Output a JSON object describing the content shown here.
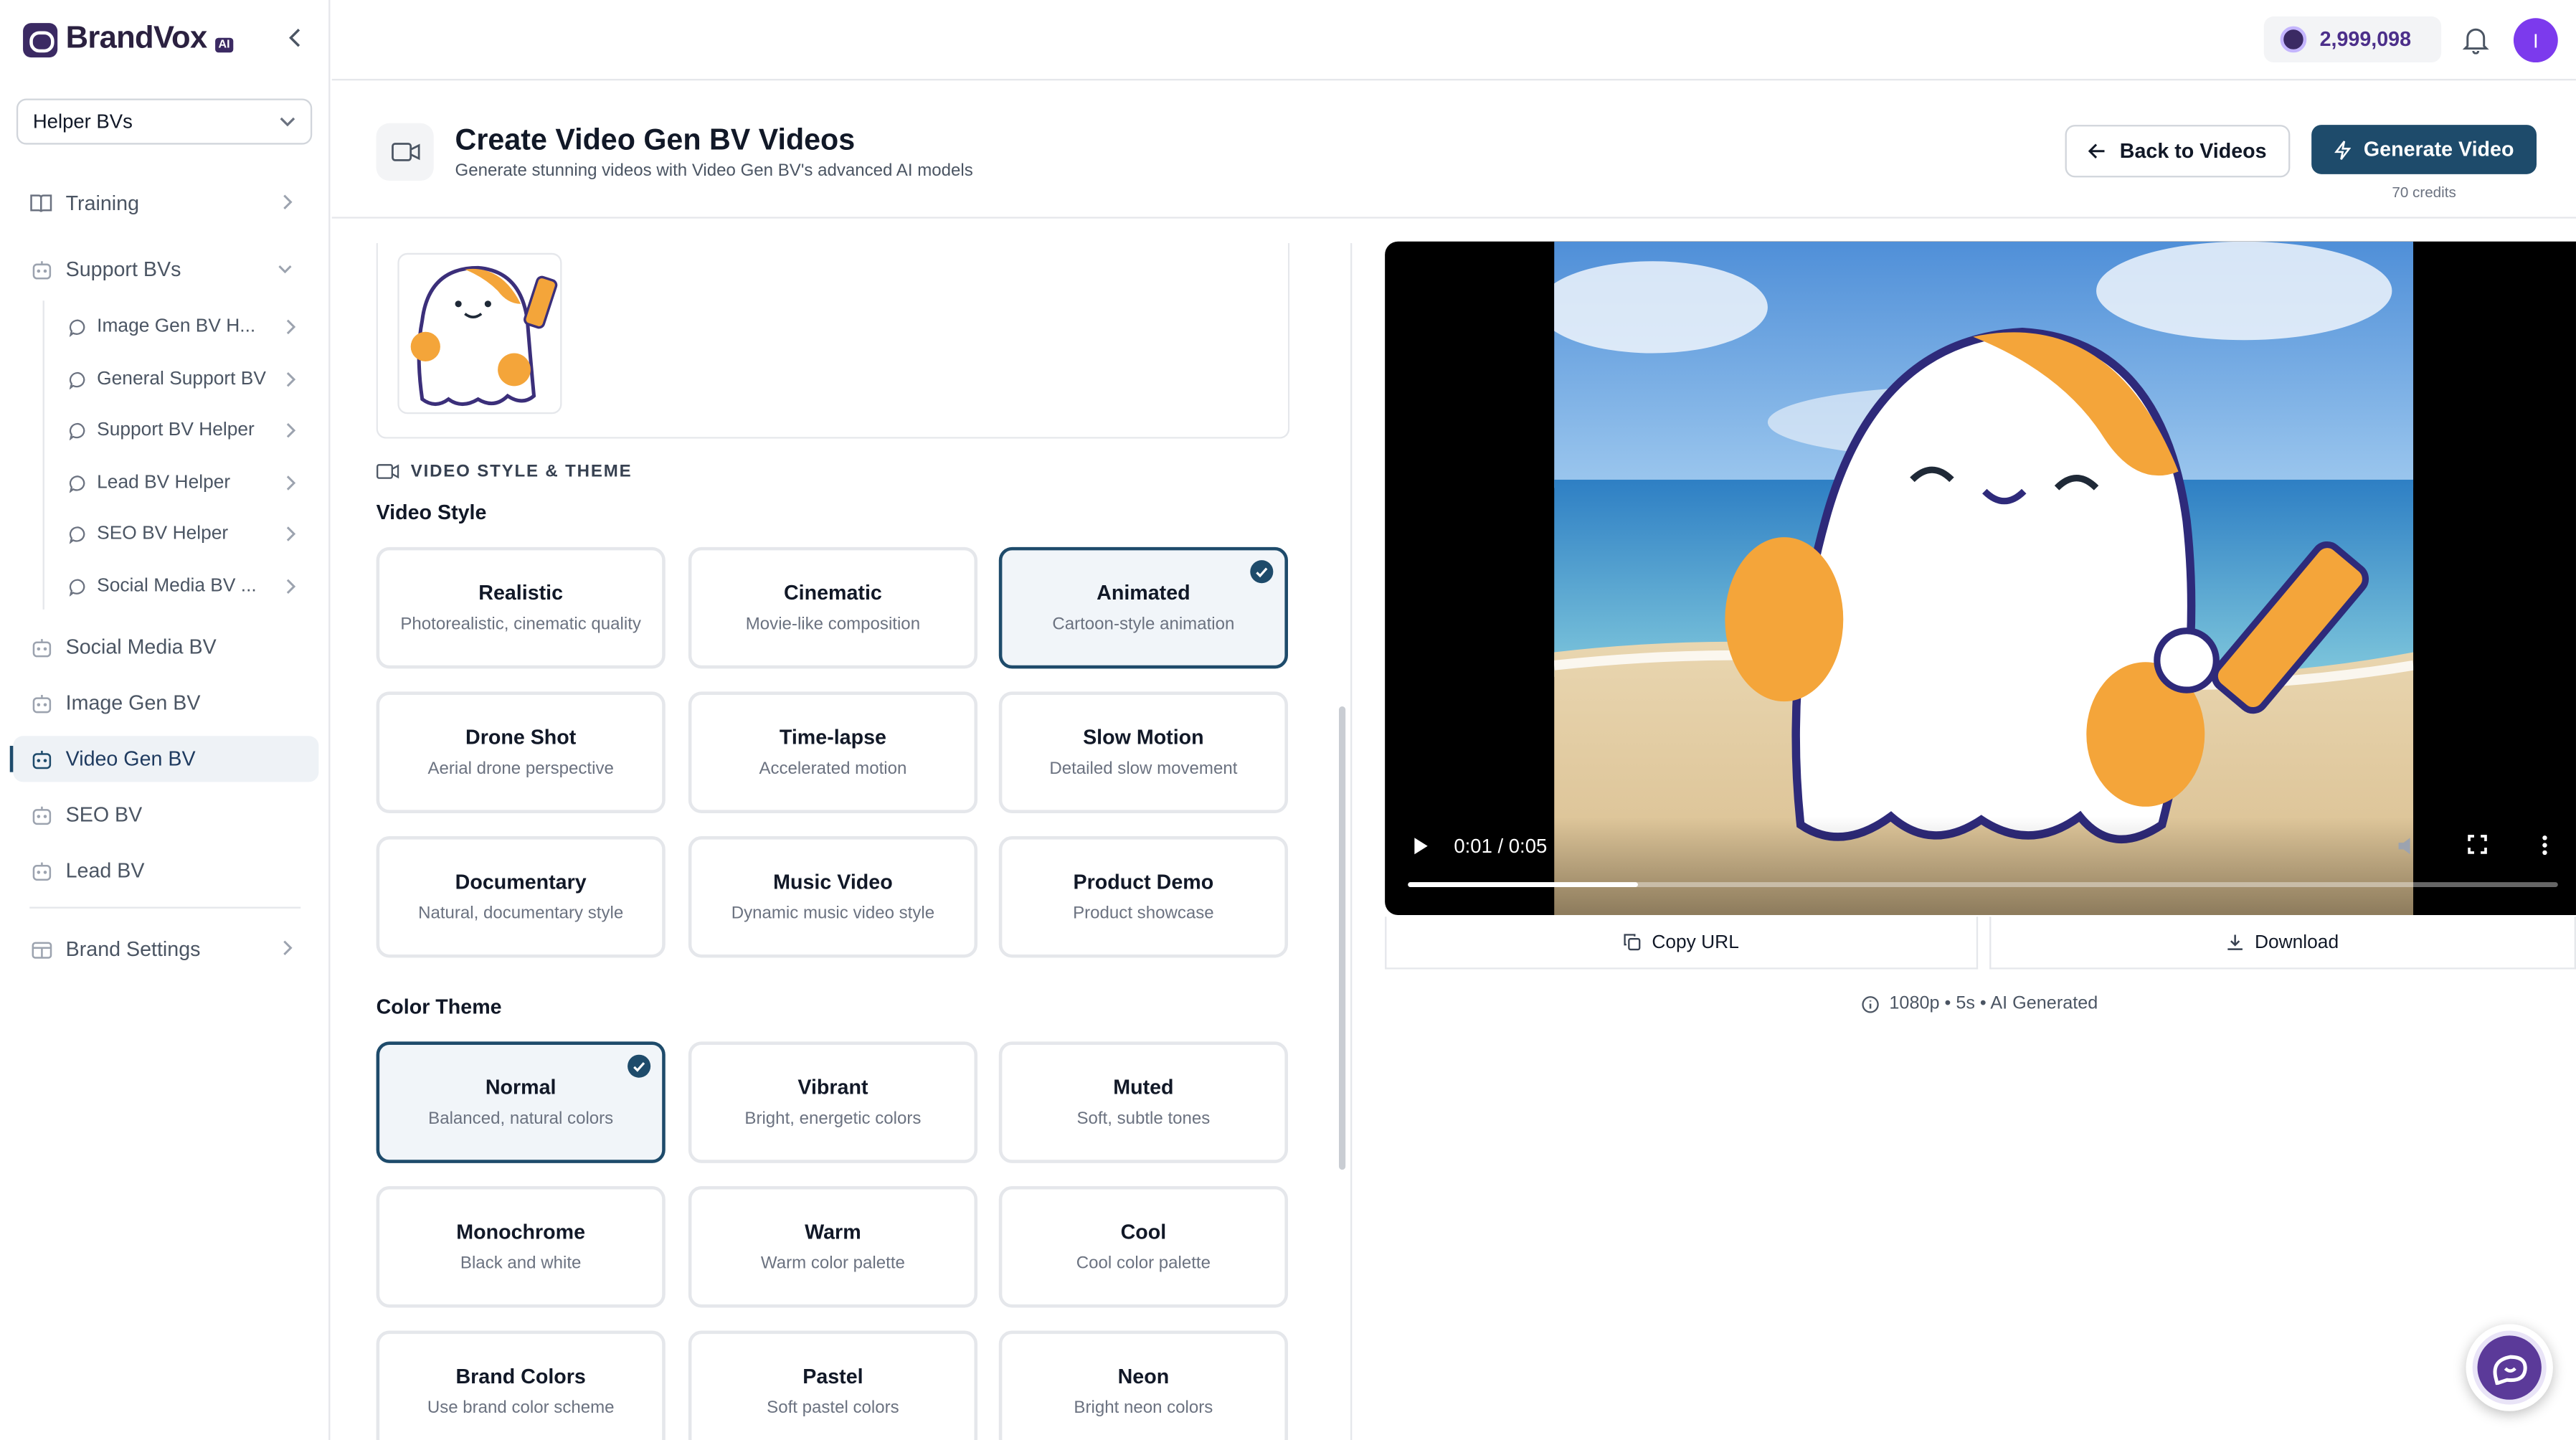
{
  "app": {
    "brand_name": "BrandVox",
    "brand_badge": "AI"
  },
  "sidebar": {
    "selector_value": "Helper BVs",
    "items": [
      {
        "label": "Training",
        "icon": "book-icon"
      },
      {
        "label": "Support BVs",
        "icon": "robot-icon"
      },
      {
        "label": "Social Media BV",
        "icon": "robot-icon"
      },
      {
        "label": "Image Gen BV",
        "icon": "robot-icon"
      },
      {
        "label": "Video Gen BV",
        "icon": "robot-icon",
        "active": true
      },
      {
        "label": "SEO BV",
        "icon": "robot-icon"
      },
      {
        "label": "Lead BV",
        "icon": "robot-icon"
      },
      {
        "label": "Brand Settings",
        "icon": "grid-icon"
      }
    ],
    "sub_items": [
      {
        "label": "Image Gen BV H..."
      },
      {
        "label": "General Support BV"
      },
      {
        "label": "Support BV Helper"
      },
      {
        "label": "Lead BV Helper"
      },
      {
        "label": "SEO BV Helper"
      },
      {
        "label": "Social Media BV ..."
      }
    ]
  },
  "topbar": {
    "credits": "2,999,098",
    "avatar_initial": "I"
  },
  "header": {
    "title": "Create Video Gen BV Videos",
    "subtitle": "Generate stunning videos with Video Gen BV's advanced AI models",
    "back_label": "Back to Videos",
    "generate_label": "Generate Video",
    "credits_note": "70 credits"
  },
  "form": {
    "section_label": "VIDEO STYLE & THEME",
    "video_style_label": "Video Style",
    "color_theme_label": "Color Theme",
    "video_styles": [
      {
        "title": "Realistic",
        "desc": "Photorealistic, cinematic quality"
      },
      {
        "title": "Cinematic",
        "desc": "Movie-like composition"
      },
      {
        "title": "Animated",
        "desc": "Cartoon-style animation",
        "selected": true
      },
      {
        "title": "Drone Shot",
        "desc": "Aerial drone perspective"
      },
      {
        "title": "Time-lapse",
        "desc": "Accelerated motion"
      },
      {
        "title": "Slow Motion",
        "desc": "Detailed slow movement"
      },
      {
        "title": "Documentary",
        "desc": "Natural, documentary style"
      },
      {
        "title": "Music Video",
        "desc": "Dynamic music video style"
      },
      {
        "title": "Product Demo",
        "desc": "Product showcase"
      }
    ],
    "color_themes": [
      {
        "title": "Normal",
        "desc": "Balanced, natural colors",
        "selected": true
      },
      {
        "title": "Vibrant",
        "desc": "Bright, energetic colors"
      },
      {
        "title": "Muted",
        "desc": "Soft, subtle tones"
      },
      {
        "title": "Monochrome",
        "desc": "Black and white"
      },
      {
        "title": "Warm",
        "desc": "Warm color palette"
      },
      {
        "title": "Cool",
        "desc": "Cool color palette"
      },
      {
        "title": "Brand Colors",
        "desc": "Use brand color scheme"
      },
      {
        "title": "Pastel",
        "desc": "Soft pastel colors"
      },
      {
        "title": "Neon",
        "desc": "Bright neon colors"
      }
    ]
  },
  "preview": {
    "time": "0:01 / 0:05",
    "progress_fraction": 0.2,
    "copy_label": "Copy URL",
    "download_label": "Download",
    "meta": "1080p • 5s • AI Generated"
  },
  "colors": {
    "accent": "#1e4b6b",
    "brand": "#3b2a63",
    "credits_text": "#4c2f8a",
    "avatar": "#7c3aed"
  }
}
